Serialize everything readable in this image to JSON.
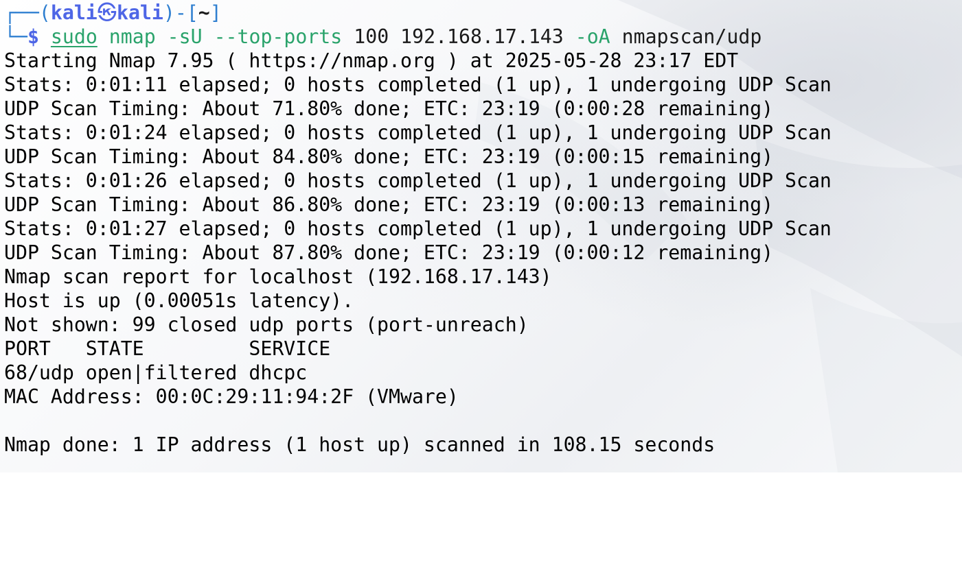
{
  "prompt": {
    "corner_top": "┌──(",
    "user": "kali",
    "skull": "㉿",
    "host": "kali",
    "close_bracket": ")-[",
    "dir": "~",
    "end_bracket": "]",
    "corner_bottom": "└─",
    "dollar": "$",
    "cmd_sudo": "sudo",
    "cmd_nmap": "nmap",
    "cmd_flag_su": "-sU",
    "cmd_flag_top": "--top-ports",
    "cmd_arg_count": "100",
    "cmd_arg_ip": "192.168.17.143",
    "cmd_flag_oa": "-oA",
    "cmd_arg_out": "nmapscan/udp"
  },
  "output_lines": [
    "Starting Nmap 7.95 ( https://nmap.org ) at 2025-05-28 23:17 EDT",
    "Stats: 0:01:11 elapsed; 0 hosts completed (1 up), 1 undergoing UDP Scan",
    "UDP Scan Timing: About 71.80% done; ETC: 23:19 (0:00:28 remaining)",
    "Stats: 0:01:24 elapsed; 0 hosts completed (1 up), 1 undergoing UDP Scan",
    "UDP Scan Timing: About 84.80% done; ETC: 23:19 (0:00:15 remaining)",
    "Stats: 0:01:26 elapsed; 0 hosts completed (1 up), 1 undergoing UDP Scan",
    "UDP Scan Timing: About 86.80% done; ETC: 23:19 (0:00:13 remaining)",
    "Stats: 0:01:27 elapsed; 0 hosts completed (1 up), 1 undergoing UDP Scan",
    "UDP Scan Timing: About 87.80% done; ETC: 23:19 (0:00:12 remaining)",
    "Nmap scan report for localhost (192.168.17.143)",
    "Host is up (0.00051s latency).",
    "Not shown: 99 closed udp ports (port-unreach)",
    "PORT   STATE         SERVICE",
    "68/udp open|filtered dhcpc",
    "MAC Address: 00:0C:29:11:94:2F (VMware)",
    "",
    "Nmap done: 1 IP address (1 host up) scanned in 108.15 seconds"
  ],
  "colors": {
    "background": "#ffffff",
    "text": "#000000",
    "prompt_blue": "#4e66e6",
    "command_green": "#2aa36b"
  }
}
